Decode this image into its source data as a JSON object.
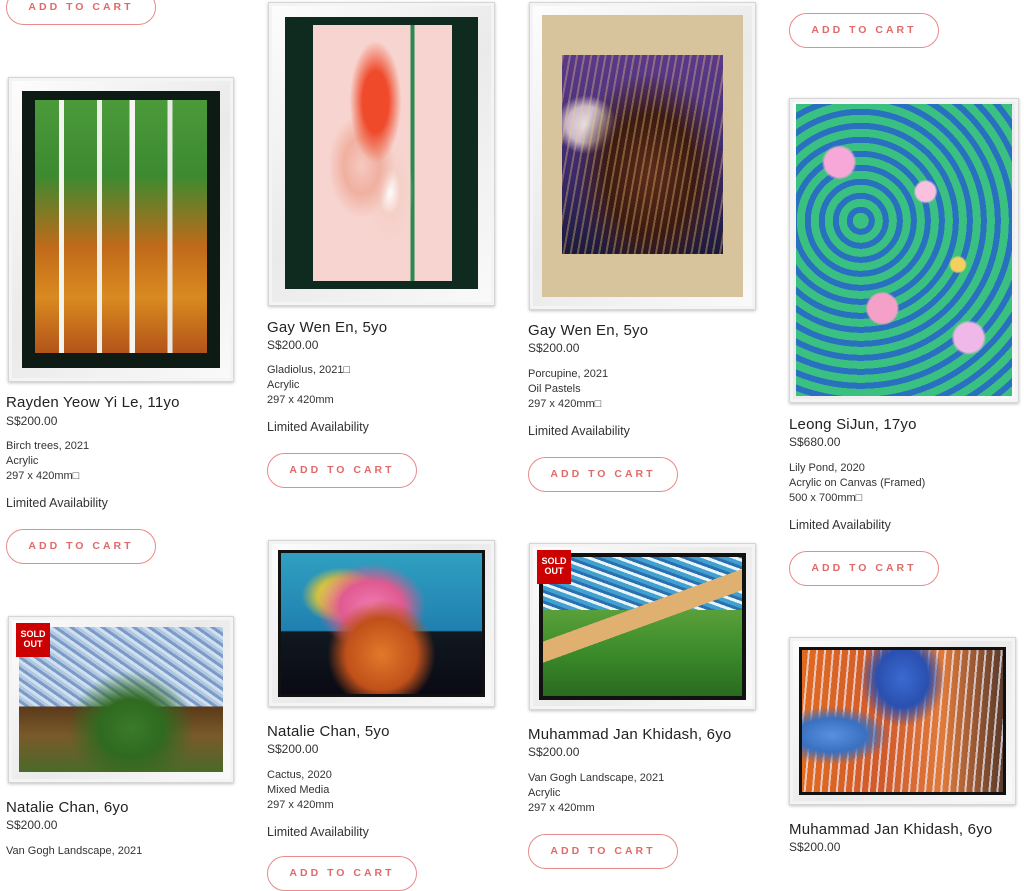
{
  "cart_button_label": "ADD TO CART",
  "sold_badge": "SOLD OUT",
  "colors": {
    "accent": "#e88a8a",
    "sold": "#cc0000"
  },
  "products": [
    {
      "artist": "Rayden Yeow Yi Le, 11yo",
      "price": "S$200.00",
      "title_year": "Birch trees, 2021",
      "medium": "Acrylic",
      "size": "297 x 420mm□",
      "availability": "Limited Availability"
    },
    {
      "artist": "Gay Wen En, 5yo",
      "price": "S$200.00",
      "title_year": "Gladiolus, 2021□",
      "medium": "Acrylic",
      "size": "297 x 420mm",
      "availability": "Limited Availability"
    },
    {
      "artist": "Gay Wen En, 5yo",
      "price": "S$200.00",
      "title_year": "Porcupine, 2021",
      "medium": "Oil Pastels",
      "size": "297 x 420mm□",
      "availability": "Limited Availability"
    },
    {
      "artist": "Leong SiJun, 17yo",
      "price": "S$680.00",
      "title_year": "Lily Pond, 2020",
      "medium": "Acrylic on Canvas (Framed)",
      "size": "500 x 700mm□",
      "availability": "Limited Availability"
    },
    {
      "artist": "Natalie Chan, 6yo",
      "price": "S$200.00",
      "title_year": "Van Gogh Landscape, 2021"
    },
    {
      "artist": "Natalie Chan, 5yo",
      "price": "S$200.00",
      "title_year": "Cactus, 2020",
      "medium": "Mixed Media",
      "size": "297 x 420mm",
      "availability": "Limited Availability"
    },
    {
      "artist": "Muhammad Jan Khidash, 6yo",
      "price": "S$200.00",
      "title_year": "Van Gogh Landscape, 2021",
      "medium": "Acrylic",
      "size": "297 x 420mm"
    },
    {
      "artist": "Muhammad Jan Khidash, 6yo",
      "price": "S$200.00"
    }
  ]
}
